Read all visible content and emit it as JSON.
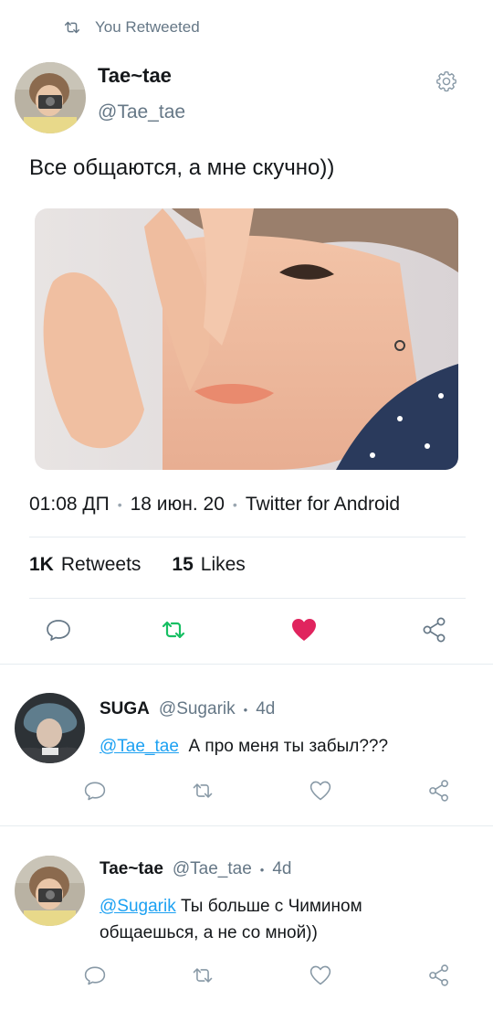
{
  "retweet_header": {
    "label": "You Retweeted"
  },
  "tweet": {
    "author_name": "Tae~tae",
    "author_handle": "@Tae_tae",
    "text": "Все общаются, а мне скучно))",
    "time": "01:08 ДП",
    "date": "18 июн. 20",
    "source": "Twitter for Android",
    "retweets_count": "1K",
    "retweets_label": "Retweets",
    "likes_count": "15",
    "likes_label": "Likes"
  },
  "replies": [
    {
      "author_name": "SUGA",
      "author_handle": "@Sugarik",
      "age": "4d",
      "mention": "@Tae_tae",
      "text": "А про меня ты забыл???"
    },
    {
      "author_name": "Tae~tae",
      "author_handle": "@Tae_tae",
      "age": "4d",
      "mention": "@Sugarik",
      "text_line1": "Ты больше с Чимином",
      "text_line2": "общаешься, а не со мной))"
    }
  ],
  "colors": {
    "retweet_green": "#17bf63",
    "like_red": "#e0245e",
    "muted": "#657786",
    "link_blue": "#1da1f2"
  }
}
